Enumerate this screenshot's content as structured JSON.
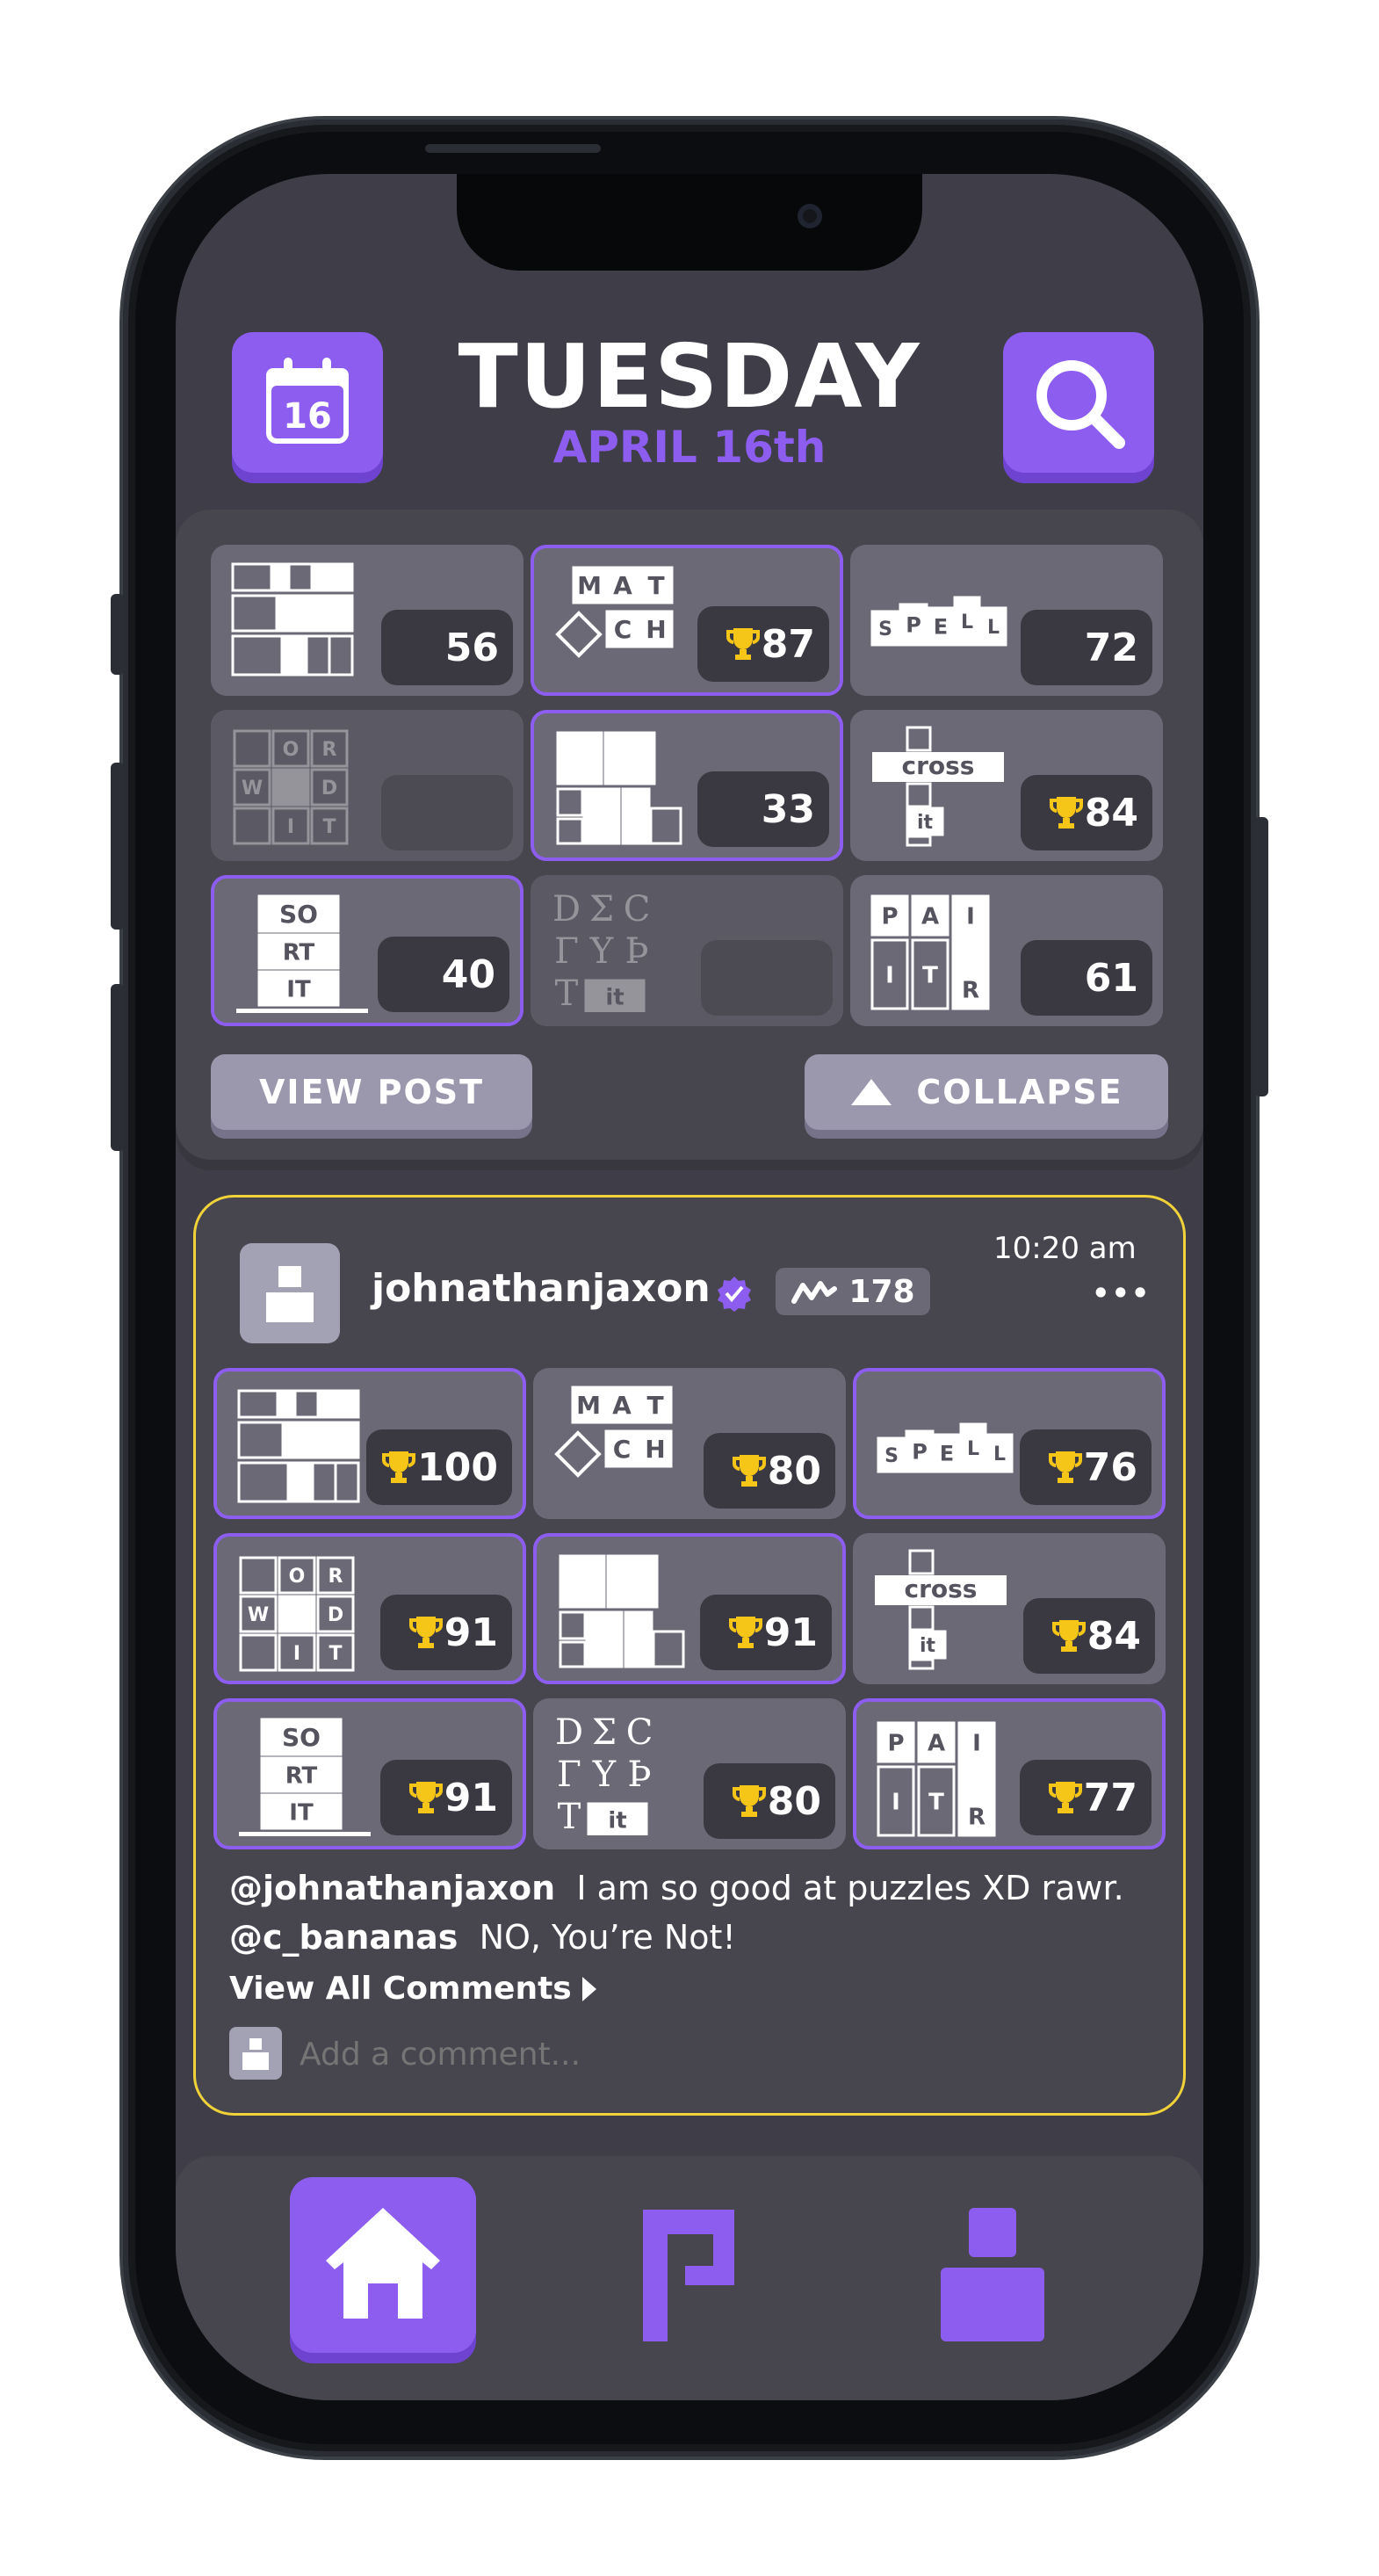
{
  "header": {
    "calendar_day": "16",
    "day_name": "TUESDAY",
    "date": "APRIL 16th",
    "search_icon": "search-icon",
    "calendar_icon": "calendar-icon"
  },
  "colors": {
    "accent": "#8d5df0",
    "trophy": "#f5c518",
    "post_border": "#f0d239"
  },
  "my_results": {
    "tiles": [
      {
        "game": "box-it",
        "score": "56",
        "trophy": false
      },
      {
        "game": "match-it",
        "score": "87",
        "trophy": true
      },
      {
        "game": "spell-it",
        "score": "72",
        "trophy": false
      },
      {
        "game": "word-it",
        "score": "",
        "trophy": false
      },
      {
        "game": "fit-it",
        "score": "33",
        "trophy": false
      },
      {
        "game": "cross-it",
        "score": "84",
        "trophy": true
      },
      {
        "game": "sort-it",
        "score": "40",
        "trophy": false
      },
      {
        "game": "decrypt-it",
        "score": "",
        "trophy": false
      },
      {
        "game": "pair-it",
        "score": "61",
        "trophy": false
      }
    ],
    "view_post_label": "VIEW POST",
    "collapse_label": "COLLAPSE"
  },
  "post": {
    "username": "johnathanjaxon",
    "streak": "178",
    "time": "10:20 am",
    "more_label": "•••",
    "tiles": [
      {
        "game": "box-it",
        "score": "100"
      },
      {
        "game": "match-it",
        "score": "80"
      },
      {
        "game": "spell-it",
        "score": "76"
      },
      {
        "game": "word-it",
        "score": "91"
      },
      {
        "game": "fit-it",
        "score": "91"
      },
      {
        "game": "cross-it",
        "score": "84"
      },
      {
        "game": "sort-it",
        "score": "91"
      },
      {
        "game": "decrypt-it",
        "score": "80"
      },
      {
        "game": "pair-it",
        "score": "77"
      }
    ],
    "comments": [
      {
        "user": "@johnathanjaxon",
        "text": "I am so good at puzzles XD rawr."
      },
      {
        "user": "@c_bananas",
        "text": "NO, You’re Not!"
      }
    ],
    "view_all_label": "View All Comments",
    "add_comment_placeholder": "Add a comment..."
  },
  "logo_text": {
    "match": [
      "M",
      "A",
      "T",
      "C",
      "H"
    ],
    "spell": [
      "S",
      "P",
      "E",
      "L",
      "L"
    ],
    "word": [
      "O",
      "R",
      "W",
      "D",
      "I",
      "T"
    ],
    "cross": [
      "cross",
      "it"
    ],
    "sort": [
      "SO",
      "RT",
      "IT"
    ],
    "decrypt": [
      "D",
      "Σ",
      "C",
      "Γ",
      "Y",
      "Þ",
      "T",
      "it"
    ],
    "pair": [
      "P",
      "A",
      "I",
      "I",
      "T",
      "R"
    ]
  },
  "nav": {
    "home_icon": "home-icon",
    "puzzle_icon": "puzzle-icon",
    "profile_icon": "profile-icon"
  }
}
